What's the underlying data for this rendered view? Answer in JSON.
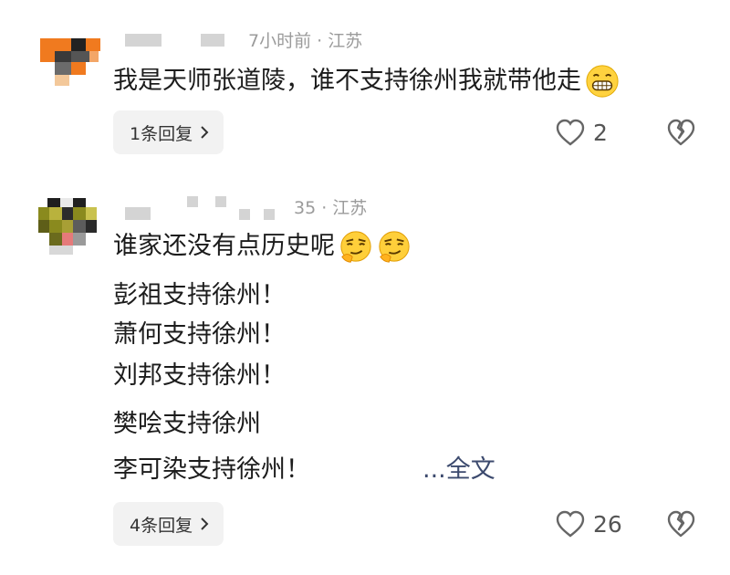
{
  "comments": [
    {
      "meta": "7小时前 · 江苏",
      "lines": [
        "我是天师张道陵，谁不支持徐州我就带他走"
      ],
      "emoji_after_first_line": [
        "grinning-face-icon"
      ],
      "reply_label": "1条回复",
      "like_count": "2"
    },
    {
      "meta": "35 · 江苏",
      "lines": [
        "谁家还没有点历史呢",
        "彭祖支持徐州！",
        "萧何支持徐州！",
        "刘邦支持徐州！",
        "樊哙支持徐州",
        "李可染支持徐州！"
      ],
      "emoji_after_first_line": [
        "smirking-face-icon",
        "smirking-face-icon"
      ],
      "more_label": "...全文",
      "reply_label": "4条回复",
      "like_count": "26"
    }
  ],
  "colors": {
    "background": "#ffffff",
    "text": "#1c1c1c",
    "meta": "#9b9b9b",
    "link": "#3c4a6e",
    "reply_bg": "#f2f2f2",
    "avatar1": "#f07a1f",
    "avatar2": "#8a8a1e"
  }
}
